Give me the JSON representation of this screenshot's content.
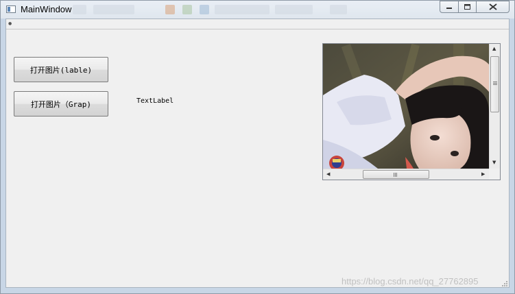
{
  "window": {
    "title": "MainWindow",
    "controls": [
      "minimize-icon",
      "maximize-icon",
      "close-icon"
    ]
  },
  "buttons": {
    "open_label": "打开图片(lable)",
    "open_graph": "打开图片（Grap)"
  },
  "text_label": "TextLabel",
  "image_view": {
    "content": "photo of a girl lying down, dark hair, white shirt",
    "scrollbar_vertical_glyph": "≡",
    "scrollbar_horizontal_glyph": "III"
  },
  "watermark": "https://blog.csdn.net/qq_27762895",
  "colors": {
    "client_bg": "#f0f0f0",
    "titlebar": "#e5ebf2"
  }
}
